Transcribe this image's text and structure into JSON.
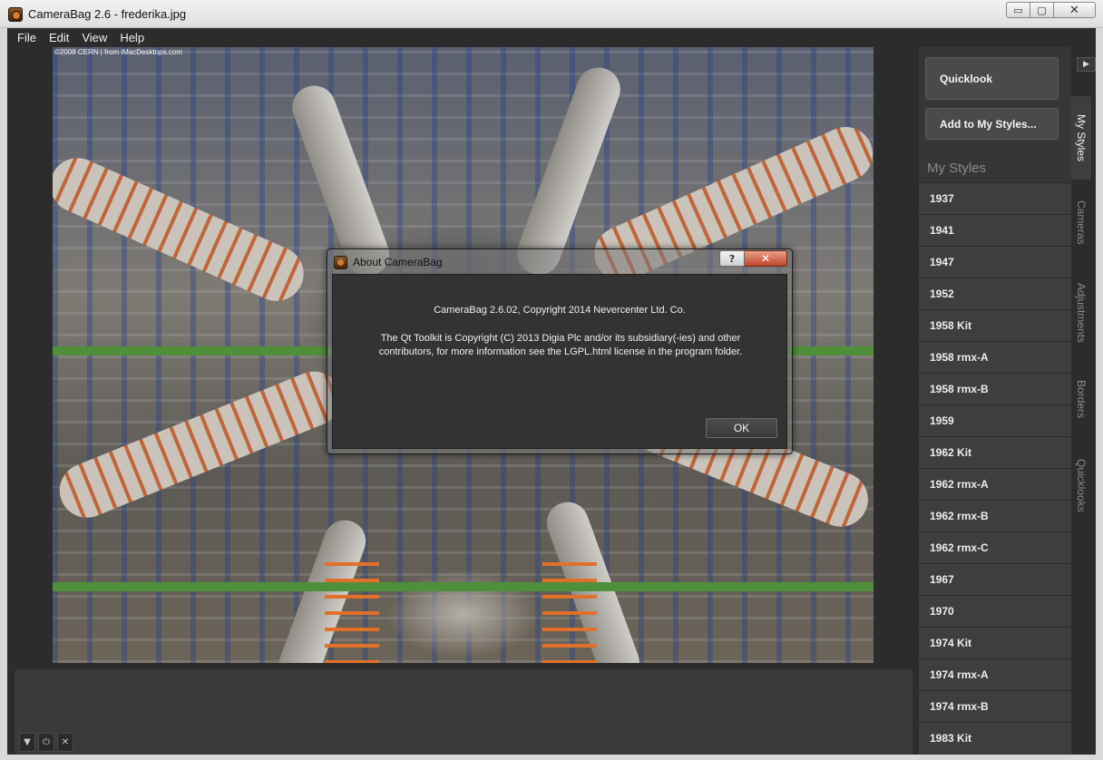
{
  "window": {
    "title": "CameraBag 2.6 - frederika.jpg",
    "minimize": "▭",
    "maximize": "▢",
    "close": "✕"
  },
  "menu": [
    "File",
    "Edit",
    "View",
    "Help"
  ],
  "photo": {
    "credit": "©2008 CERN | from iMacDesktops.com"
  },
  "panel": {
    "quicklook_label": "Quicklook",
    "add_style_label": "Add to My Styles...",
    "heading": "My Styles",
    "styles": [
      "1937",
      "1941",
      "1947",
      "1952",
      "1958 Kit",
      "1958 rmx-A",
      "1958 rmx-B",
      "1959",
      "1962 Kit",
      "1962 rmx-A",
      "1962 rmx-B",
      "1962 rmx-C",
      "1967",
      "1970",
      "1974 Kit",
      "1974 rmx-A",
      "1974 rmx-B",
      "1983 Kit"
    ]
  },
  "tabs": [
    "My Styles",
    "Cameras",
    "Adjustments",
    "Borders",
    "Quicklooks"
  ],
  "active_tab": "My Styles",
  "dialog": {
    "title": "About CameraBag",
    "help": "?",
    "close": "✕",
    "line1": "CameraBag 2.6.02, Copyright 2014 Nevercenter Ltd. Co.",
    "line2": "The Qt Toolkit is Copyright (C) 2013 Digia Plc and/or its subsidiary(-ies) and other contributors, for more information see the LGPL.html license in the program folder.",
    "ok_label": "OK"
  },
  "strip_controls": {
    "collapse": "▼",
    "power": "⏻",
    "close": "✕"
  },
  "collapse_panel": "▶",
  "colors": {
    "background": "#2c2c2c",
    "panel": "#363636",
    "item": "#3e3e3e",
    "close_red": "#c0452a"
  }
}
